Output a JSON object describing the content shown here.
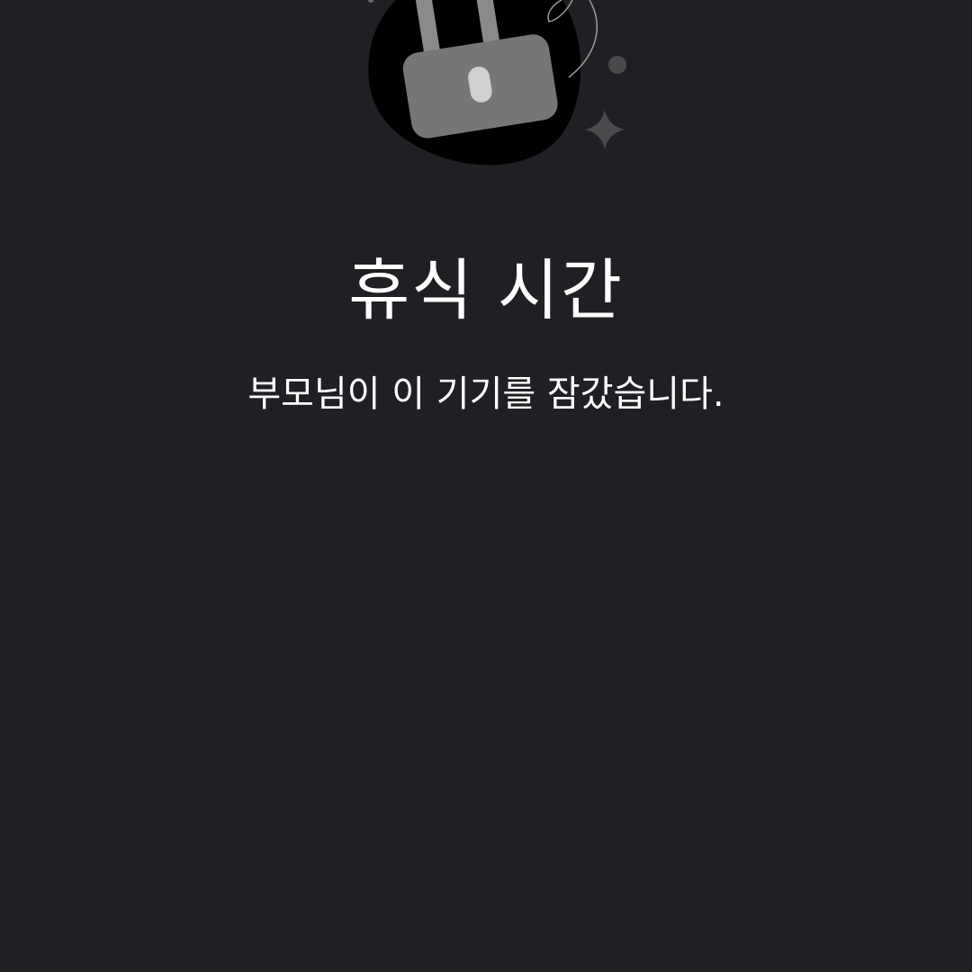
{
  "screen": {
    "title": "휴식 시간",
    "message": "부모님이 이 기기를 잠갔습니다."
  },
  "illustration": {
    "icon": "padlock-icon",
    "colors": {
      "background": "#202024",
      "blob": "#000000",
      "lock_body": "#767676",
      "keyhole": "#d0d0d0",
      "shackle": "#8a8a8a",
      "sparkle": "#4a4a4c"
    }
  }
}
